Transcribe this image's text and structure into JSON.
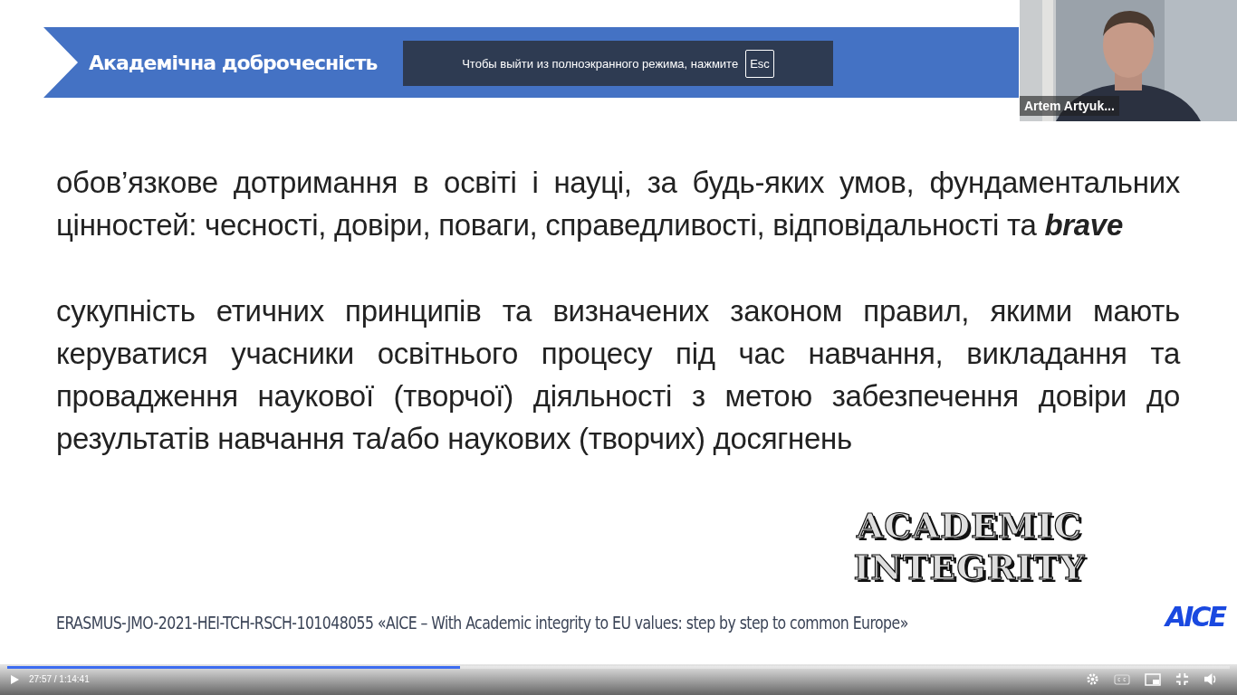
{
  "slide": {
    "title": "Академічна доброчесність",
    "paragraphs": [
      "обов’язкове дотримання в освіті і науці, за будь-яких умов, фундаментальних цінностей: чесності, довіри, поваги, справедливості, відповідальності та **brave**",
      "сукупність етичних принципів та визначених законом правил, якими мають керуватися учасники освітнього процесу під час навчання, викладання та провадження наукової (творчої) діяльності з метою забезпечення довіри до результатів навчання та/або наукових (творчих) досягнень"
    ],
    "art_text": [
      "ACADEMIC",
      "INTEGRITY"
    ],
    "footer": "ERASMUS-JMO-2021-HEI-TCH-RSCH-101048055 «AICE – With Academic integrity to EU values: step by step to common Europe»",
    "logo": "AICE"
  },
  "fullscreen_notice": {
    "text": "Чтобы выйти из полноэкранного режима, нажмите",
    "key": "Esc"
  },
  "participant": {
    "kind": "picture",
    "name": "Artem Artyuk..."
  },
  "player": {
    "time": "27:57 / 1:14:41",
    "progress": {
      "level": 0.37
    }
  }
}
